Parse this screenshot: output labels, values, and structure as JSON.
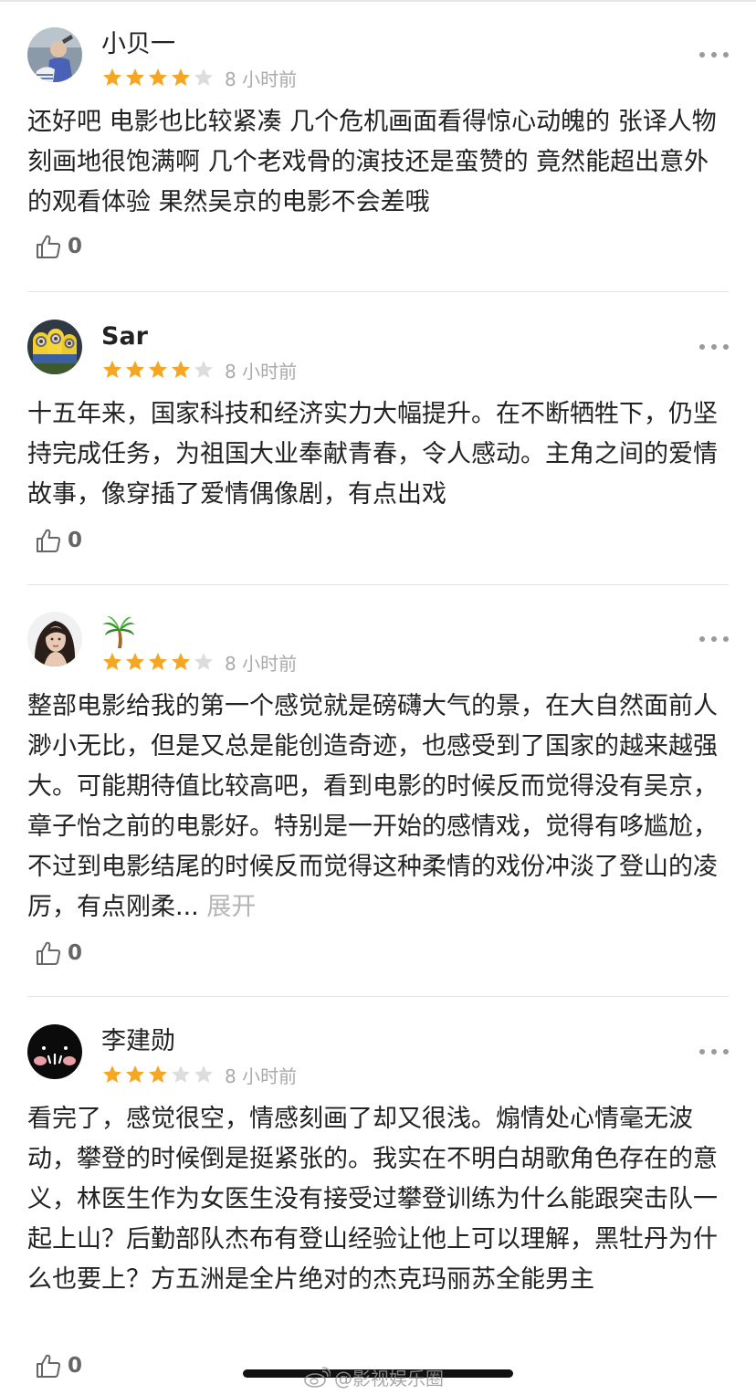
{
  "theme": {
    "star_on": "#F5A623",
    "star_off": "#DDDDDD",
    "text_color": "#222222",
    "meta_color": "#AAAAAA",
    "expand_color": "#B5B5B5"
  },
  "reviews": [
    {
      "username": "小贝一",
      "avatar_icon": "user-avatar-photo",
      "stars": 4,
      "max_stars": 5,
      "time": "8 小时前",
      "content": "还好吧 电影也比较紧凑 几个危机画面看得惊心动魄的 张译人物刻画地很饱满啊 几个老戏骨的演技还是蛮赞的 竟然能超出意外的观看体验 果然吴京的电影不会差哦",
      "expand_label": "",
      "likes": "0"
    },
    {
      "username": "Sar",
      "avatar_icon": "minions-avatar",
      "stars": 4,
      "max_stars": 5,
      "time": "8 小时前",
      "content": "十五年来，国家科技和经济实力大幅提升。在不断牺牲下，仍坚持完成任务，为祖国大业奉献青春，令人感动。主角之间的爱情故事，像穿插了爱情偶像剧，有点出戏",
      "expand_label": "",
      "likes": "0"
    },
    {
      "username": "",
      "username_icon": "palm-tree-icon",
      "avatar_icon": "woman-portrait-avatar",
      "stars": 4,
      "max_stars": 5,
      "time": "8 小时前",
      "content": "整部电影给我的第一个感觉就是磅礴大气的景，在大自然面前人渺小无比，但是又总是能创造奇迹，也感受到了国家的越来越强大。可能期待值比较高吧，看到电影的时候反而觉得没有吴京，章子怡之前的电影好。特别是一开始的感情戏，觉得有哆尴尬，不过到电影结尾的时候反而觉得这种柔情的戏份冲淡了登山的凌厉，有点刚柔...",
      "expand_label": "展开",
      "likes": "0"
    },
    {
      "username": "李建勋",
      "avatar_icon": "black-face-avatar",
      "stars": 3,
      "max_stars": 5,
      "time": "8 小时前",
      "content": "看完了，感觉很空，情感刻画了却又很浅。煽情处心情毫无波动，攀登的时候倒是挺紧张的。我实在不明白胡歌角色存在的意义，林医生作为女医生没有接受过攀登训练为什么能跟突击队一起上山？后勤部队杰布有登山经验让他上可以理解，黑牡丹为什么也要上？方五洲是全片绝对的杰克玛丽苏全能男主",
      "expand_label": "",
      "likes": "0"
    }
  ],
  "watermark": {
    "text": "@影视娱乐圈",
    "icon": "weibo-logo"
  }
}
